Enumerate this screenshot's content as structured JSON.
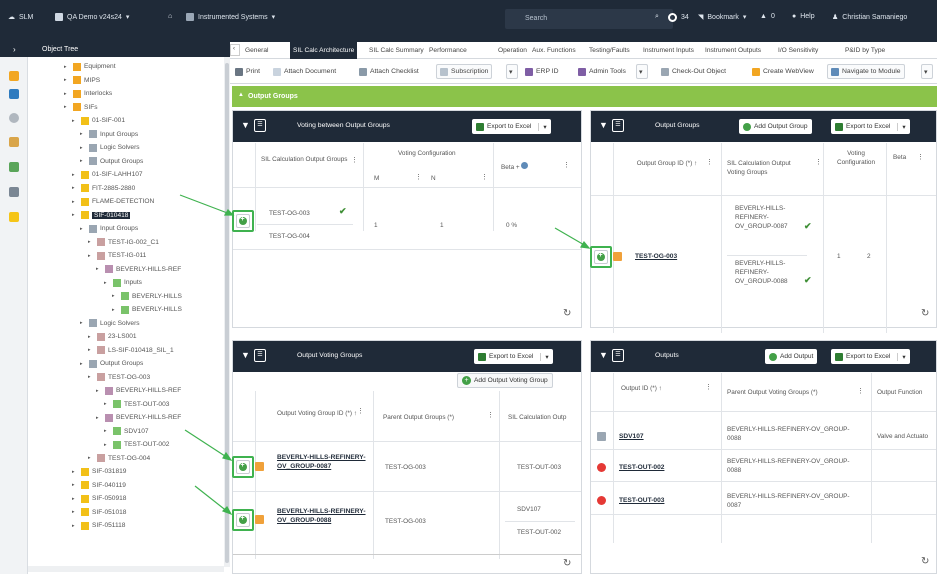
{
  "topbar": {
    "app": "SLM",
    "project": "QA Demo v24s24",
    "module": "Instrumented Systems",
    "search_placeholder": "Search",
    "notif_count": "34",
    "bookmark": "Bookmark",
    "inbox_count": "0",
    "help": "Help",
    "user": "Christian Samaniego"
  },
  "object_tree": {
    "title": "Object Tree",
    "items": [
      {
        "label": "Equipment",
        "indent": 2
      },
      {
        "label": "MIPS",
        "indent": 2
      },
      {
        "label": "Interlocks",
        "indent": 2
      },
      {
        "label": "SIFs",
        "indent": 2
      },
      {
        "label": "01-SIF-001",
        "indent": 3
      },
      {
        "label": "Input Groups",
        "indent": 4
      },
      {
        "label": "Logic Solvers",
        "indent": 4
      },
      {
        "label": "Output Groups",
        "indent": 4
      },
      {
        "label": "01-SIF-LAHH107",
        "indent": 3
      },
      {
        "label": "FIT-2885-2880",
        "indent": 3
      },
      {
        "label": "FLAME-DETECTION",
        "indent": 3
      },
      {
        "label": "SIF-010418",
        "indent": 3,
        "selected": true
      },
      {
        "label": "Input Groups",
        "indent": 4
      },
      {
        "label": "TEST-IG-002_C1",
        "indent": 5
      },
      {
        "label": "TEST-IG-011",
        "indent": 5
      },
      {
        "label": "BEVERLY-HILLS-REF",
        "indent": 6
      },
      {
        "label": "Inputs",
        "indent": 7
      },
      {
        "label": "BEVERLY-HILLS",
        "indent": 8
      },
      {
        "label": "BEVERLY-HILLS",
        "indent": 8
      },
      {
        "label": "Logic Solvers",
        "indent": 4
      },
      {
        "label": "23-LS001",
        "indent": 5
      },
      {
        "label": "LS-SIF-010418_SIL_1",
        "indent": 5
      },
      {
        "label": "Output Groups",
        "indent": 4
      },
      {
        "label": "TEST-OG-003",
        "indent": 5
      },
      {
        "label": "BEVERLY-HILLS-REF",
        "indent": 6
      },
      {
        "label": "TEST-OUT-003",
        "indent": 7
      },
      {
        "label": "BEVERLY-HILLS-REF",
        "indent": 6
      },
      {
        "label": "SDV107",
        "indent": 7
      },
      {
        "label": "TEST-OUT-002",
        "indent": 7
      },
      {
        "label": "TEST-OG-004",
        "indent": 5
      },
      {
        "label": "SIF-031819",
        "indent": 3
      },
      {
        "label": "SIF-040119",
        "indent": 3
      },
      {
        "label": "SIF-050918",
        "indent": 3
      },
      {
        "label": "SIF-051018",
        "indent": 3
      },
      {
        "label": "SIF-051118",
        "indent": 3
      }
    ]
  },
  "tabs": [
    "General",
    "SIL Calc Architecture",
    "SIL Calc Summary",
    "Performance",
    "Operation",
    "Aux. Functions",
    "Testing/Faults",
    "Instrument Inputs",
    "Instrument Outputs",
    "I/O Sensitivity",
    "P&ID by Type"
  ],
  "toolbar": {
    "print": "Print",
    "attach_document": "Attach Document",
    "attach_checklist": "Attach Checklist",
    "subscription": "Subscription",
    "erp_id": "ERP ID",
    "admin_tools": "Admin Tools",
    "check_out": "Check-Out Object",
    "create_webview": "Create WebView",
    "navigate": "Navigate to Module"
  },
  "output_groups_section": "Output Groups",
  "voting_panel": {
    "title": "Voting between Output Groups",
    "export": "Export to Excel",
    "col_sil_calc": "SIL Calculation Output Groups",
    "col_voting_config": "Voting Configuration",
    "col_m": "M",
    "col_n": "N",
    "col_beta": "Beta",
    "row": {
      "groups": [
        "TEST-OG-003",
        "TEST-OG-004"
      ],
      "m": "1",
      "n": "1",
      "beta": "0 %"
    }
  },
  "output_groups_panel": {
    "title": "Output Groups",
    "add": "Add Output Group",
    "export": "Export to Excel",
    "col_id": "Output Group ID (*)",
    "col_sil": "SIL Calculation Output Voting Groups",
    "col_voting": "Voting Configuration",
    "col_beta": "Beta",
    "row": {
      "id": "TEST-OG-003",
      "groups": [
        "BEVERLY-HILLS-REFINERY-OV_GROUP-0087",
        "BEVERLY-HILLS-REFINERY-OV_GROUP-0088"
      ],
      "m": "1",
      "n": "2"
    }
  },
  "ovg_panel": {
    "title": "Output Voting Groups",
    "export": "Export to Excel",
    "add": "Add Output Voting Group",
    "col_id": "Output Voting Group ID (*)",
    "col_parent": "Parent Output Groups (*)",
    "col_sil": "SIL Calculation Outp",
    "rows": [
      {
        "id": "BEVERLY-HILLS-REFINERY-OV_GROUP-0087",
        "parent": "TEST-OG-003",
        "sil": [
          "TEST-OUT-003"
        ]
      },
      {
        "id": "BEVERLY-HILLS-REFINERY-OV_GROUP-0088",
        "parent": "TEST-OG-003",
        "sil": [
          "SDV107",
          "TEST-OUT-002"
        ]
      }
    ]
  },
  "outputs_panel": {
    "title": "Outputs",
    "add": "Add Output",
    "export": "Export to Excel",
    "col_id": "Output ID (*)",
    "col_parent": "Parent Output Voting Groups (*)",
    "col_function": "Output Function",
    "rows": [
      {
        "id": "SDV107",
        "parent": "BEVERLY-HILLS-REFINERY-OV_GROUP-0088",
        "function": "Valve and Actuato"
      },
      {
        "id": "TEST-OUT-002",
        "parent": "BEVERLY-HILLS-REFINERY-OV_GROUP-0088",
        "function": ""
      },
      {
        "id": "TEST-OUT-003",
        "parent": "BEVERLY-HILLS-REFINERY-OV_GROUP-0087",
        "function": ""
      }
    ]
  },
  "colors": {
    "navy": "#1f2a38",
    "green_bar": "#8bc34a",
    "highlight": "#3fb24f",
    "add": "#43a047",
    "remove": "#e53935"
  }
}
